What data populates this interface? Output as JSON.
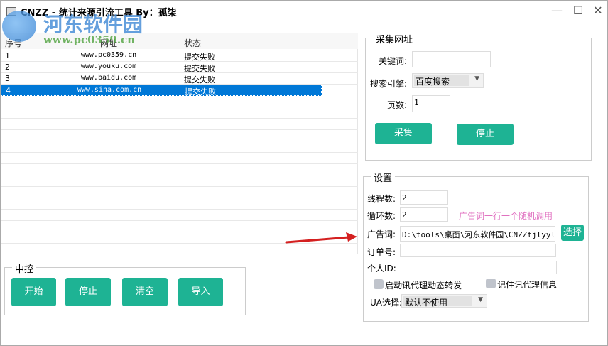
{
  "window": {
    "title": "CNZZ - 统计来源引流工具 By：孤柒",
    "minimize": "—",
    "maximize": "☐",
    "close": "✕"
  },
  "watermark": {
    "logo_text": "河东软件园",
    "url": "www.pc0359.cn"
  },
  "table": {
    "columns": [
      "序号",
      "网址",
      "状态"
    ],
    "rows": [
      {
        "id": "1",
        "url": "www.pc0359.cn",
        "status": "提交失败"
      },
      {
        "id": "2",
        "url": "www.youku.com",
        "status": "提交失败"
      },
      {
        "id": "3",
        "url": "www.baidu.com",
        "status": "提交失败"
      },
      {
        "id": "4",
        "url": "www.sina.com.cn",
        "status": "提交失败"
      }
    ]
  },
  "control": {
    "title": "中控",
    "start": "开始",
    "stop": "停止",
    "clear": "清空",
    "import": "导入"
  },
  "collect": {
    "title": "采集网址",
    "keyword_label": "关键词:",
    "keyword_value": "",
    "engine_label": "搜索引擎:",
    "engine_value": "百度搜索",
    "pages_label": "页数:",
    "pages_value": "1",
    "collect_btn": "采集",
    "stop_btn": "停止"
  },
  "settings": {
    "title": "设置",
    "threads_label": "线程数:",
    "threads_value": "2",
    "loops_label": "循环数:",
    "loops_value": "2",
    "hint": "广告词一行一个随机调用",
    "ad_label": "广告词:",
    "ad_value": "D:\\tools\\桌面\\河东软件园\\CNZZtjlyylg",
    "choose_btn": "选择",
    "order_label": "订单号:",
    "order_value": "",
    "pid_label": "个人ID:",
    "pid_value": "",
    "proxy_forward": "启动讯代理动态转发",
    "remember_proxy": "记住讯代理信息",
    "ua_label": "UA选择:",
    "ua_value": "默认不使用"
  },
  "colors": {
    "accent": "#1eb394",
    "selection": "#0078d7",
    "hint": "#e070c0"
  }
}
